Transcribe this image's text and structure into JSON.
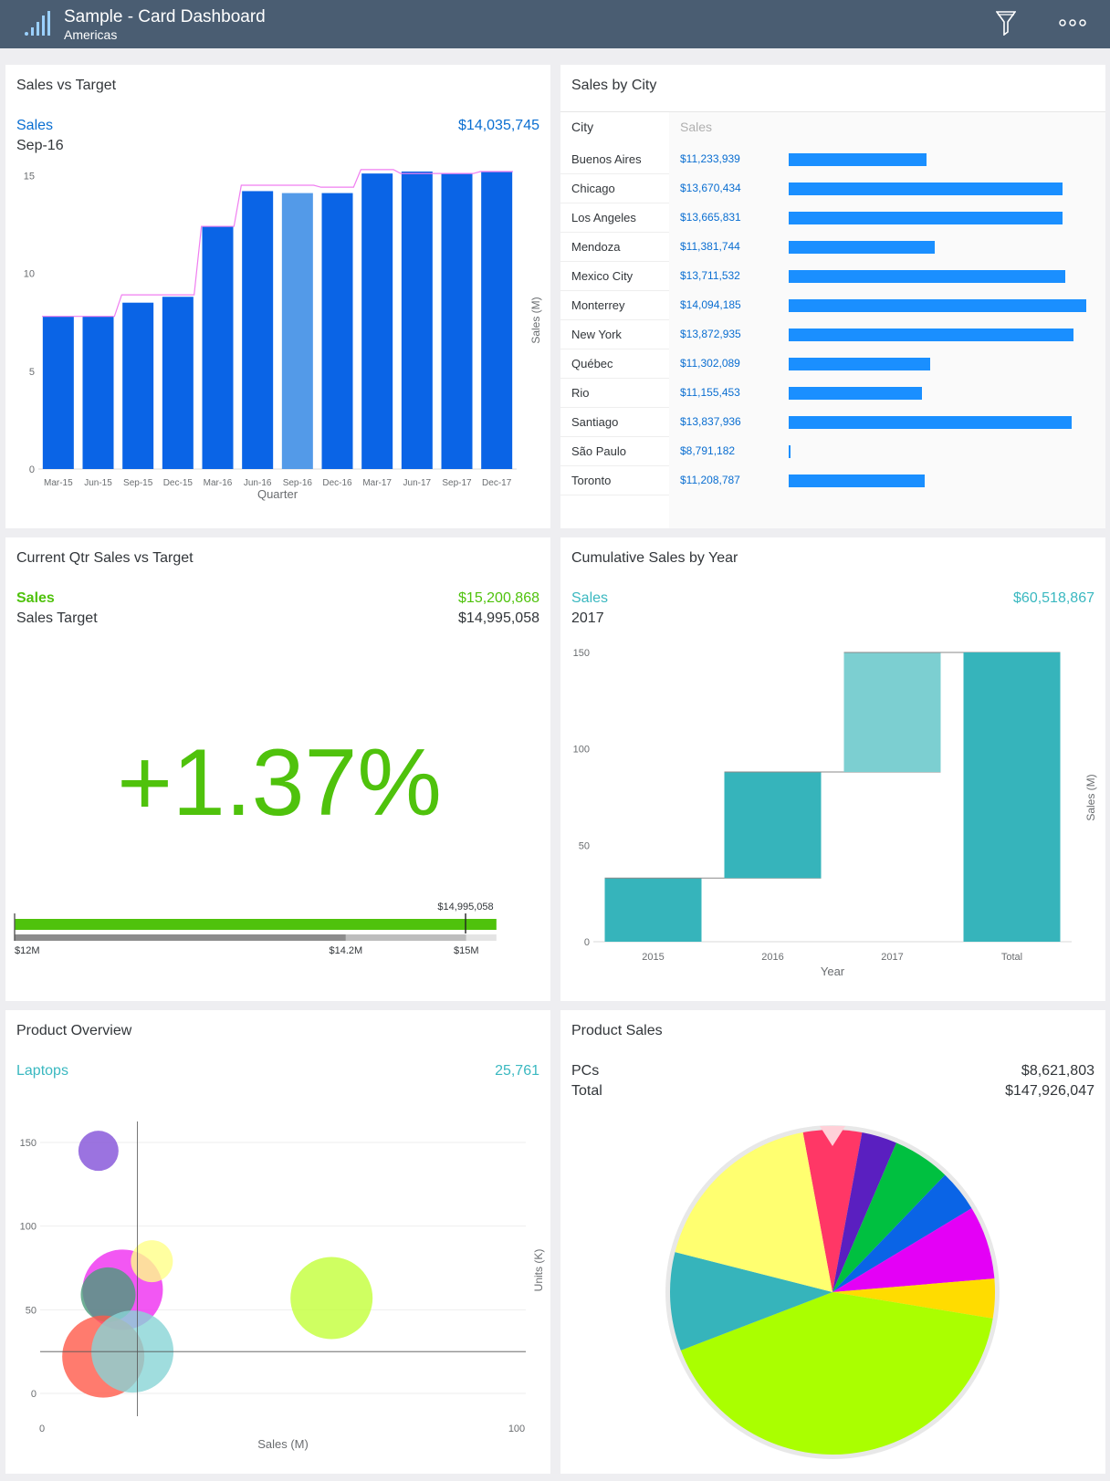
{
  "header": {
    "title": "Sample - Card Dashboard",
    "subtitle": "Americas"
  },
  "colors": {
    "header_bg": "#4a5d72",
    "bar_blue": "#0a64e6",
    "bar_highlight": "#539ae8",
    "target_line": "#f07ef0",
    "city_bar": "#1a8fff",
    "bullet_green": "#4fc20c",
    "waterfall_teal": "#36b4bb",
    "waterfall_light": "#7ccfd1"
  },
  "cards": {
    "sales_vs_target": {
      "title": "Sales vs Target",
      "measure": "Sales",
      "value": "$14,035,745",
      "period": "Sep-16"
    },
    "sales_by_city": {
      "title": "Sales by City",
      "col_city": "City",
      "col_sales": "Sales"
    },
    "current_qtr": {
      "title": "Current Qtr Sales vs Target",
      "measure": "Sales",
      "value": "$15,200,868",
      "target_label": "Sales Target",
      "target_value": "$14,995,058",
      "delta": "+1.37%"
    },
    "cumulative": {
      "title": "Cumulative Sales by Year",
      "measure": "Sales",
      "value": "$60,518,867",
      "period": "2017"
    },
    "product_overview": {
      "title": "Product Overview",
      "measure": "Laptops",
      "value": "25,761"
    },
    "product_sales": {
      "title": "Product Sales",
      "measure": "PCs",
      "value": "$8,621,803",
      "total_label": "Total",
      "total_value": "$147,926,047"
    }
  },
  "chart_data": [
    {
      "name": "sales_vs_target",
      "type": "bar",
      "categories": [
        "Mar-15",
        "Jun-15",
        "Sep-15",
        "Dec-15",
        "Mar-16",
        "Jun-16",
        "Sep-16",
        "Dec-16",
        "Mar-17",
        "Jun-17",
        "Sep-17",
        "Dec-17"
      ],
      "series": [
        {
          "name": "Sales",
          "values": [
            7.8,
            7.8,
            8.5,
            8.8,
            12.4,
            14.2,
            14.1,
            14.1,
            15.1,
            15.2,
            15.1,
            15.2
          ]
        },
        {
          "name": "Target",
          "values": [
            7.8,
            7.8,
            8.9,
            8.9,
            12.4,
            14.5,
            14.5,
            14.4,
            15.3,
            15.1,
            15.1,
            15.2
          ]
        }
      ],
      "highlight_index": 6,
      "xlabel": "Quarter",
      "ylabel": "Sales (M)",
      "yticks": [
        "0",
        "5",
        "10",
        "15"
      ],
      "ylim": [
        0,
        15.2
      ]
    },
    {
      "name": "sales_by_city",
      "type": "bar",
      "orientation": "horizontal",
      "categories": [
        "Buenos Aires",
        "Chicago",
        "Los Angeles",
        "Mendoza",
        "Mexico City",
        "Monterrey",
        "New York",
        "Québec",
        "Rio",
        "Santiago",
        "São Paulo",
        "Toronto"
      ],
      "value_labels": [
        "$11,233,939",
        "$13,670,434",
        "$13,665,831",
        "$11,381,744",
        "$13,711,532",
        "$14,094,185",
        "$13,872,935",
        "$11,302,089",
        "$11,155,453",
        "$13,837,936",
        "$8,791,182",
        "$11,208,787"
      ],
      "values": [
        11233939,
        13670434,
        13665831,
        11381744,
        13711532,
        14094185,
        13872935,
        11302089,
        11155453,
        13837936,
        8791182,
        11208787
      ],
      "xlim": [
        8771182,
        14094185
      ]
    },
    {
      "name": "current_qtr_bullet",
      "type": "bar",
      "actual": 15.2,
      "target": 14.995058,
      "target_label": "$14,995,058",
      "ranges": [
        12,
        14.2,
        15,
        15.2
      ],
      "tick_labels": [
        "$12M",
        "$14.2M",
        "$15M"
      ],
      "xlim": [
        12,
        15.48
      ]
    },
    {
      "name": "cumulative_waterfall",
      "type": "bar",
      "subtype": "waterfall",
      "categories": [
        "2015",
        "2016",
        "2017",
        "Total"
      ],
      "values": [
        33,
        55,
        62,
        150
      ],
      "xlabel": "Year",
      "ylabel": "Sales (M)",
      "yticks": [
        "0",
        "50",
        "100",
        "150"
      ],
      "ylim": [
        0,
        150
      ]
    },
    {
      "name": "product_overview",
      "type": "scatter",
      "subtype": "bubble",
      "points": [
        {
          "x": 12,
          "y": 145,
          "r": 22,
          "color": "#8250d8"
        },
        {
          "x": 17,
          "y": 62,
          "r": 44,
          "color": "#ef2df0"
        },
        {
          "x": 23,
          "y": 79,
          "r": 23,
          "color": "#ffff88"
        },
        {
          "x": 14,
          "y": 59,
          "r": 30,
          "color": "#4a9b7b"
        },
        {
          "x": 13,
          "y": 22,
          "r": 45,
          "color": "#ff5a4a"
        },
        {
          "x": 19,
          "y": 25,
          "r": 45,
          "color": "#88d4d6"
        },
        {
          "x": 60,
          "y": 57,
          "r": 45,
          "color": "#c3ff3a"
        }
      ],
      "xlabel": "Sales (M)",
      "ylabel": "Units (K)",
      "xticks": [
        "0",
        "100"
      ],
      "yticks": [
        "0",
        "50",
        "100",
        "150"
      ],
      "xlim": [
        0,
        100
      ],
      "ylim": [
        0,
        150
      ],
      "ref_x": 20,
      "ref_y": 25
    },
    {
      "name": "product_sales",
      "type": "pie",
      "slices": [
        {
          "value": 8621803,
          "color": "#ff3766"
        },
        {
          "value": 5200000,
          "color": "#5a1fc0"
        },
        {
          "value": 8500000,
          "color": "#00c040"
        },
        {
          "value": 6200000,
          "color": "#0a64e6"
        },
        {
          "value": 10800000,
          "color": "#e400f6"
        },
        {
          "value": 5800000,
          "color": "#ffdc00"
        },
        {
          "value": 61500000,
          "color": "#aaff00"
        },
        {
          "value": 14500000,
          "color": "#36b4bb"
        },
        {
          "value": 26804244,
          "color": "#ffff70"
        }
      ],
      "total": 147926047
    }
  ]
}
